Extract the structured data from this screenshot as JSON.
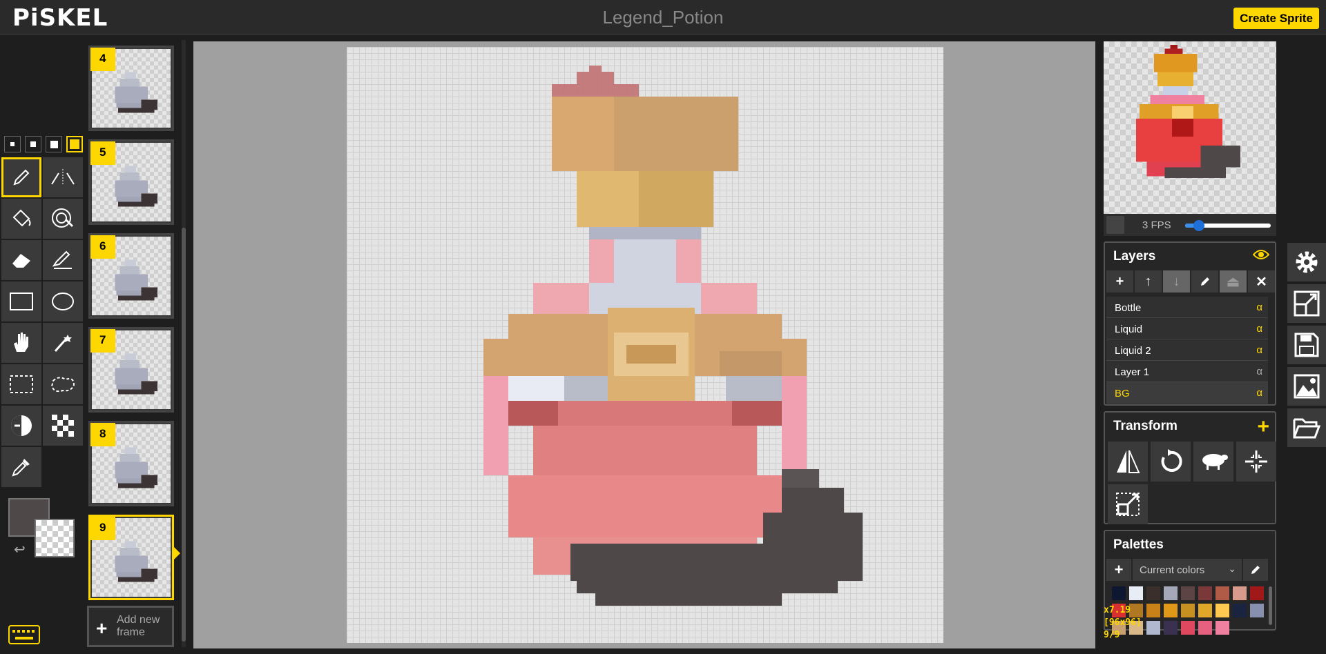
{
  "app": {
    "logo": "PiSKEL",
    "title": "Legend_Potion",
    "create_button": "Create Sprite"
  },
  "tools": {
    "pen_sizes": [
      1,
      2,
      3,
      4
    ],
    "selected_pen_size": 4,
    "items": [
      "pen-tool",
      "vertical-mirror-pen",
      "paint-bucket",
      "paint-all-same-pixels",
      "eraser",
      "stroke-tool",
      "rectangle-tool",
      "circle-tool",
      "move-tool",
      "shape-selection",
      "rectangle-selection",
      "lasso-selection",
      "lighten-tool",
      "dithering-tool",
      "color-picker"
    ],
    "selected": "pen-tool",
    "primary_color": "#4e4848",
    "secondary_color": "transparent"
  },
  "frames": {
    "items": [
      {
        "number": "4"
      },
      {
        "number": "5"
      },
      {
        "number": "6"
      },
      {
        "number": "7"
      },
      {
        "number": "8"
      },
      {
        "number": "9"
      }
    ],
    "selected": "9",
    "add_label": "Add new frame"
  },
  "preview": {
    "fps_label": "3 FPS",
    "fps": 3,
    "fps_max": 24
  },
  "layers": {
    "title": "Layers",
    "items": [
      {
        "name": "Bottle",
        "alpha": "α"
      },
      {
        "name": "Liquid",
        "alpha": "α"
      },
      {
        "name": "Liquid 2",
        "alpha": "α"
      },
      {
        "name": "Layer 1",
        "alpha": "α"
      },
      {
        "name": "BG",
        "alpha": "α"
      }
    ],
    "selected": "BG"
  },
  "transform": {
    "title": "Transform"
  },
  "palettes": {
    "title": "Palettes",
    "selected": "Current colors",
    "colors": [
      "#0e1730",
      "#e8ecf4",
      "#3a2f2a",
      "#a4a8b8",
      "#5c4444",
      "#7a3838",
      "#b05a48",
      "#d89a8c",
      "#a01818",
      "#d83030",
      "#b07820",
      "#c88018",
      "#e09818",
      "#c89020",
      "#e0a828",
      "#ffc850",
      "#1a2440",
      "#8890b0",
      "#c8a070",
      "#d8b888",
      "#b0b8d0",
      "#3a3050",
      "#e04860",
      "#e86080",
      "#f080a0"
    ]
  },
  "status": {
    "cursor": "x7.19",
    "size": "[96x96]",
    "frame": "9/9"
  },
  "colors": {
    "accent": "#ffd700"
  }
}
